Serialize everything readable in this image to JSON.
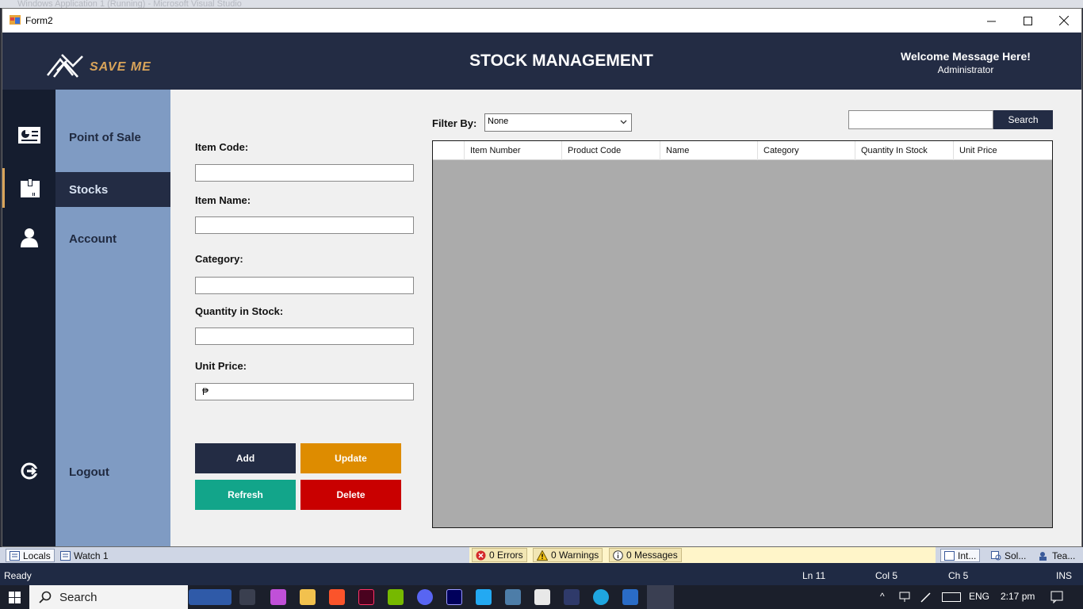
{
  "vs_window_title": "Windows Application 1 (Running) - Microsoft Visual Studio",
  "window": {
    "title": "Form2"
  },
  "header": {
    "brand": "SAVE ME",
    "page_title": "STOCK MANAGEMENT",
    "welcome": "Welcome Message Here!",
    "role": "Administrator"
  },
  "nav": {
    "items": [
      {
        "label": "Point of Sale",
        "icon": "point-of-sale-icon"
      },
      {
        "label": "Stocks",
        "icon": "stocks-box-icon"
      },
      {
        "label": "Account",
        "icon": "user-icon"
      }
    ],
    "logout": "Logout"
  },
  "form": {
    "item_code_label": "Item Code:",
    "item_name_label": "Item Name:",
    "category_label": "Category:",
    "quantity_label": "Quantity in Stock:",
    "unit_price_label": "Unit Price:",
    "unit_price_value": "₱",
    "buttons": {
      "add": "Add",
      "update": "Update",
      "refresh": "Refresh",
      "delete": "Delete"
    }
  },
  "filter": {
    "label": "Filter By:",
    "selected": "None"
  },
  "search": {
    "button": "Search"
  },
  "grid": {
    "columns": [
      "Item Number",
      "Product Code",
      "Name",
      "Category",
      "Quantity In Stock",
      "Unit Price"
    ]
  },
  "vs_bottom": {
    "tabs": [
      "Locals",
      "Watch 1"
    ],
    "errors": "0 Errors",
    "warnings": "0 Warnings",
    "messages": "0 Messages",
    "right_tabs": [
      "Int...",
      "Sol...",
      "Tea..."
    ]
  },
  "status": {
    "ready": "Ready",
    "ln": "Ln 11",
    "col": "Col 5",
    "ch": "Ch 5",
    "ins": "INS"
  },
  "taskbar": {
    "search": "Search",
    "lang": "ENG",
    "time": "2:17 pm"
  },
  "colors": {
    "header": "#232c44",
    "accent": "#d9a45a",
    "nav": "#7f9bc3",
    "add": "#232c44",
    "update": "#de8c00",
    "refresh": "#12a58a",
    "delete": "#c90000"
  }
}
